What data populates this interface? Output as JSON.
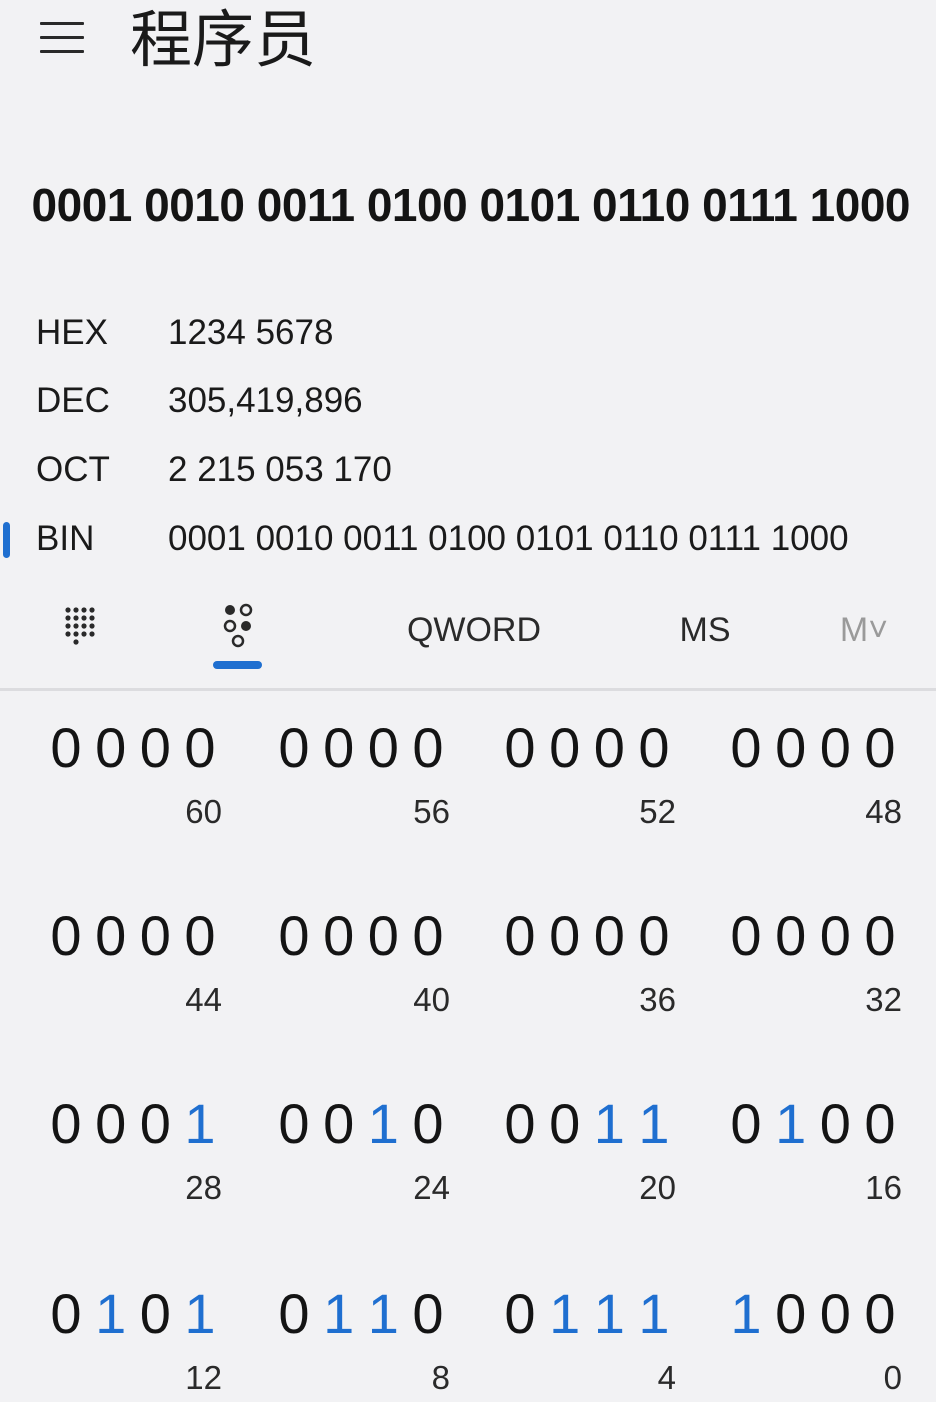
{
  "app": {
    "title": "程序员"
  },
  "display": {
    "result": "0001 0010 0011 0100 0101 0110 0111 1000"
  },
  "radix": [
    {
      "name": "HEX",
      "value": "1234 5678",
      "selected": false
    },
    {
      "name": "DEC",
      "value": "305,419,896",
      "selected": false
    },
    {
      "name": "OCT",
      "value": "2 215 053 170",
      "selected": false
    },
    {
      "name": "BIN",
      "value": "0001 0010 0011 0100 0101 0110 0111 1000",
      "selected": true
    }
  ],
  "toolbar": {
    "keypad_icon": "full-keypad-icon",
    "bit_toggle_icon": "bit-toggling-keypad-icon",
    "word_size": "QWORD",
    "memory_store": "MS",
    "memory_list": "M˅"
  },
  "accent_color": "#1f6fd0",
  "bit_groups": [
    {
      "bits": "0000",
      "position": "60"
    },
    {
      "bits": "0000",
      "position": "56"
    },
    {
      "bits": "0000",
      "position": "52"
    },
    {
      "bits": "0000",
      "position": "48"
    },
    {
      "bits": "0000",
      "position": "44"
    },
    {
      "bits": "0000",
      "position": "40"
    },
    {
      "bits": "0000",
      "position": "36"
    },
    {
      "bits": "0000",
      "position": "32"
    },
    {
      "bits": "0001",
      "position": "28"
    },
    {
      "bits": "0010",
      "position": "24"
    },
    {
      "bits": "0011",
      "position": "20"
    },
    {
      "bits": "0100",
      "position": "16"
    },
    {
      "bits": "0101",
      "position": "12"
    },
    {
      "bits": "0110",
      "position": "8"
    },
    {
      "bits": "0111",
      "position": "4"
    },
    {
      "bits": "1000",
      "position": "0"
    }
  ]
}
